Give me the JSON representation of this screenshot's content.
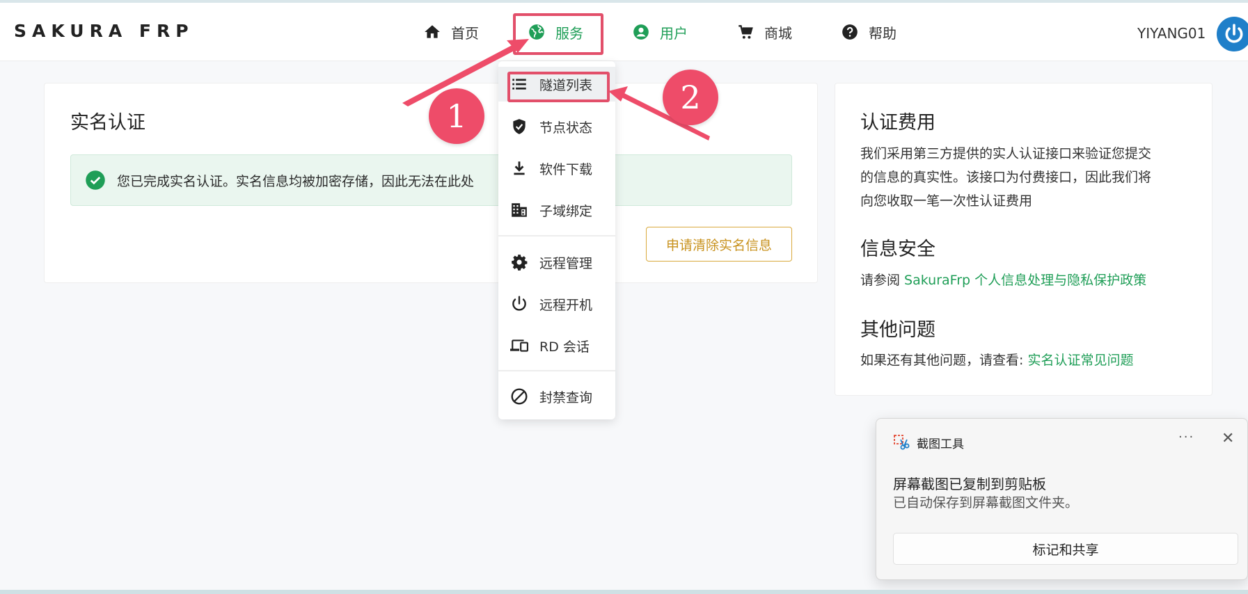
{
  "header": {
    "brand": "SAKURA FRP",
    "nav": {
      "home": "首页",
      "services": "服务",
      "user": "用户",
      "shop": "商城",
      "help": "帮助"
    },
    "username": "YIYANG01"
  },
  "main": {
    "title": "实名认证",
    "alert_text": "您已完成实名认证。实名信息均被加密存储，因此无法在此处",
    "clear_button": "申请清除实名信息"
  },
  "dropdown": {
    "items": [
      {
        "label": "隧道列表",
        "icon": "list-icon"
      },
      {
        "label": "节点状态",
        "icon": "shield-check-icon"
      },
      {
        "label": "软件下载",
        "icon": "download-icon"
      },
      {
        "label": "子域绑定",
        "icon": "building-icon"
      },
      {
        "label": "远程管理",
        "icon": "gear-icon"
      },
      {
        "label": "远程开机",
        "icon": "power-icon"
      },
      {
        "label": "RD 会话",
        "icon": "devices-icon"
      },
      {
        "label": "封禁查询",
        "icon": "block-icon"
      }
    ]
  },
  "side": {
    "fee_title": "认证费用",
    "fee_lines": [
      "我们采用第三方提供的实人认证接口来验证您提交",
      "的信息的真实性。该接口为付费接口，因此我们将",
      "向您收取一笔一次性认证费用"
    ],
    "security_title": "信息安全",
    "security_prefix": "请参阅 ",
    "security_link": "SakuraFrp 个人信息处理与隐私保护政策",
    "other_title": "其他问题",
    "other_prefix": "如果还有其他问题，请查看: ",
    "other_link": "实名认证常见问题"
  },
  "annotations": {
    "step1": "1",
    "step2": "2"
  },
  "toast": {
    "app_name": "截图工具",
    "more": "···",
    "close": "✕",
    "title": "屏幕截图已复制到剪贴板",
    "body": "已自动保存到屏幕截图文件夹。",
    "action": "标记和共享"
  },
  "colors": {
    "accent_green": "#1f9e57",
    "annotation_red": "#e24f6a",
    "warning_gold": "#c8921e",
    "avatar_blue": "#1f7fc9"
  }
}
